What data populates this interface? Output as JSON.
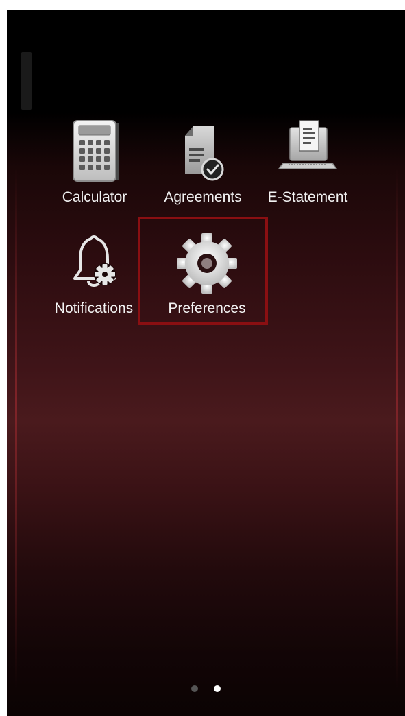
{
  "apps": {
    "calculator": {
      "label": "Calculator",
      "icon": "calculator-icon"
    },
    "agreements": {
      "label": "Agreements",
      "icon": "document-check-icon"
    },
    "estatement": {
      "label": "E-Statement",
      "icon": "laptop-statement-icon"
    },
    "notifications": {
      "label": "Notifications",
      "icon": "bell-gear-icon"
    },
    "preferences": {
      "label": "Preferences",
      "icon": "gear-icon"
    }
  },
  "pagination": {
    "pages": 2,
    "current": 2
  },
  "colors": {
    "highlight": "#8a0f12",
    "background_top": "#000000",
    "background_mid": "#4a1a1d",
    "dot_active": "#ffffff",
    "dot_inactive": "#555555"
  }
}
